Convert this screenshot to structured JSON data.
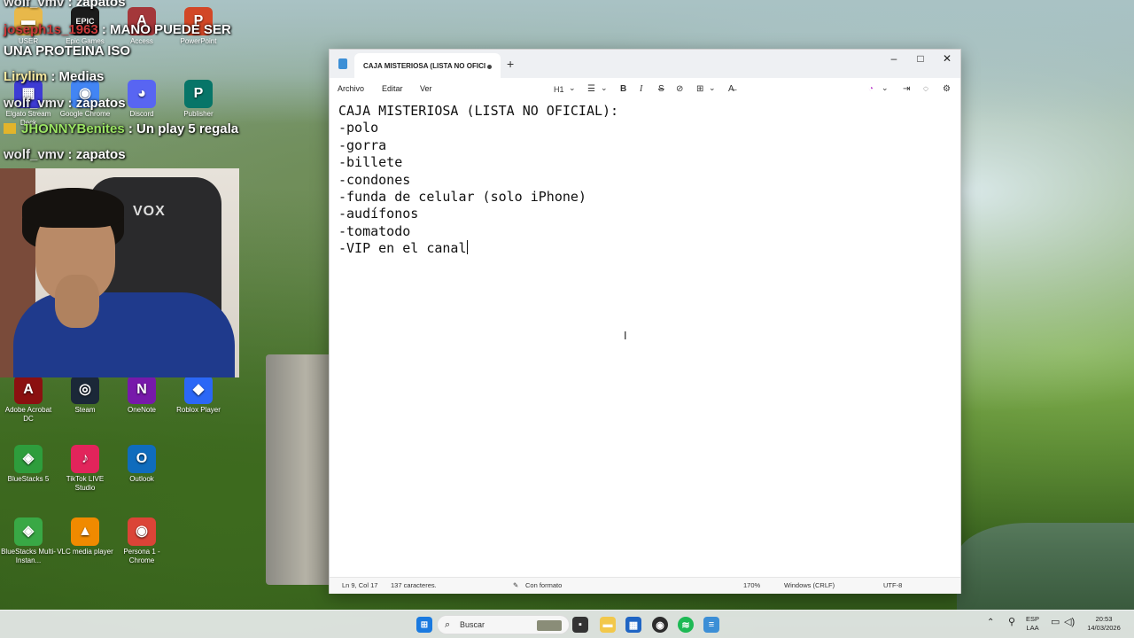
{
  "desktop": {
    "icons": [
      {
        "label": "USER",
        "icon": "folder-icon",
        "color": "#e8b84a",
        "glyph": "▬"
      },
      {
        "label": "Epic Games",
        "icon": "epic-games-icon",
        "color": "#1b1b1b",
        "glyph": "EPIC"
      },
      {
        "label": "Access",
        "icon": "access-icon",
        "color": "#a4373a",
        "glyph": "A"
      },
      {
        "label": "PowerPoint",
        "icon": "powerpoint-icon",
        "color": "#d24726",
        "glyph": "P"
      },
      {
        "label": "Elgato Stream Deck",
        "icon": "stream-deck-icon",
        "color": "#3d3bd4",
        "glyph": "▦"
      },
      {
        "label": "Google Chrome",
        "icon": "chrome-icon",
        "color": "#4285f4",
        "glyph": "◉"
      },
      {
        "label": "Discord",
        "icon": "discord-icon",
        "color": "#5865f2",
        "glyph": "◕"
      },
      {
        "label": "Publisher",
        "icon": "publisher-icon",
        "color": "#077568",
        "glyph": "P"
      },
      {
        "label": "Adobe Acrobat DC",
        "icon": "acrobat-icon",
        "color": "#8b1010",
        "glyph": "A"
      },
      {
        "label": "Steam",
        "icon": "steam-icon",
        "color": "#1b2838",
        "glyph": "◎"
      },
      {
        "label": "OneNote",
        "icon": "onenote-icon",
        "color": "#7719aa",
        "glyph": "N"
      },
      {
        "label": "Roblox Player",
        "icon": "roblox-icon",
        "color": "#2b67f6",
        "glyph": "◆"
      },
      {
        "label": "BlueStacks 5",
        "icon": "bluestacks-icon",
        "color": "#2e9d3c",
        "glyph": "◈"
      },
      {
        "label": "TikTok LIVE Studio",
        "icon": "tiktok-icon",
        "color": "#e2245b",
        "glyph": "♪"
      },
      {
        "label": "Outlook",
        "icon": "outlook-icon",
        "color": "#0f6cbd",
        "glyph": "O"
      },
      {
        "label": "BlueStacks Multi-Instan...",
        "icon": "bluestacks-multi-icon",
        "color": "#39a845",
        "glyph": "◈"
      },
      {
        "label": "VLC media player",
        "icon": "vlc-icon",
        "color": "#f08a00",
        "glyph": "▲"
      },
      {
        "label": "Persona 1 - Chrome",
        "icon": "chrome-profile-icon",
        "color": "#db4437",
        "glyph": "◉"
      }
    ]
  },
  "chat": {
    "messages": [
      {
        "user": "wolf_vmv",
        "sep": " : ",
        "text": "zapatos"
      },
      {
        "user": "joseph1s_1963",
        "sep": " : ",
        "text": "MANO PUEDE SER"
      },
      {
        "user": "",
        "sep": "",
        "text": "UNA PROTEINA ISO"
      },
      {
        "user": "Lirylim",
        "sep": " : ",
        "text": "Medias"
      },
      {
        "user": "wolf_vmv",
        "sep": " : ",
        "text": "zapatos"
      },
      {
        "user": "JHONNYBenites",
        "sep": " : ",
        "text": "Un play 5 regala"
      },
      {
        "user": "wolf_vmv",
        "sep": " : ",
        "text": "zapatos"
      }
    ]
  },
  "webcam": {
    "chair_brand": "VOX"
  },
  "notepad": {
    "tab_title": "CAJA MISTERIOSA (LISTA NO OFICI",
    "new_tab": "+",
    "controls": {
      "minimize": "–",
      "maximize": "□",
      "close": "✕"
    },
    "menu": {
      "file": "Archivo",
      "edit": "Editar",
      "view": "Ver"
    },
    "toolbar": {
      "heading": "H1",
      "heading_chevron": "⌄",
      "list": "☰",
      "list_chevron": "⌄",
      "bold": "B",
      "italic": "I",
      "strike": "S",
      "link": "⊘",
      "table": "⊞",
      "table_chevron": "⌄",
      "clear_format": "A̶",
      "copilot": "◔",
      "copilot_chevron": "⌄",
      "share": "⇥",
      "account": "◌",
      "settings": "⚙"
    },
    "lines": [
      "CAJA MISTERIOSA (LISTA NO OFICIAL):",
      "-polo",
      "-gorra",
      "-billete",
      "-condones",
      "-funda de celular (solo iPhone)",
      "-audífonos",
      "-tomatodo",
      "-VIP en el canal"
    ],
    "status": {
      "position": "Ln 9, Col 17",
      "chars": "137 caracteres.",
      "format": "Con formato",
      "zoom": "170%",
      "line_ending": "Windows (CRLF)",
      "encoding": "UTF-8"
    }
  },
  "taskbar": {
    "search_placeholder": "Buscar",
    "lang_top": "ESP",
    "lang_bottom": "LAA",
    "time": "20:53",
    "date": "14/03/2026",
    "tray_chevron": "⌃"
  }
}
